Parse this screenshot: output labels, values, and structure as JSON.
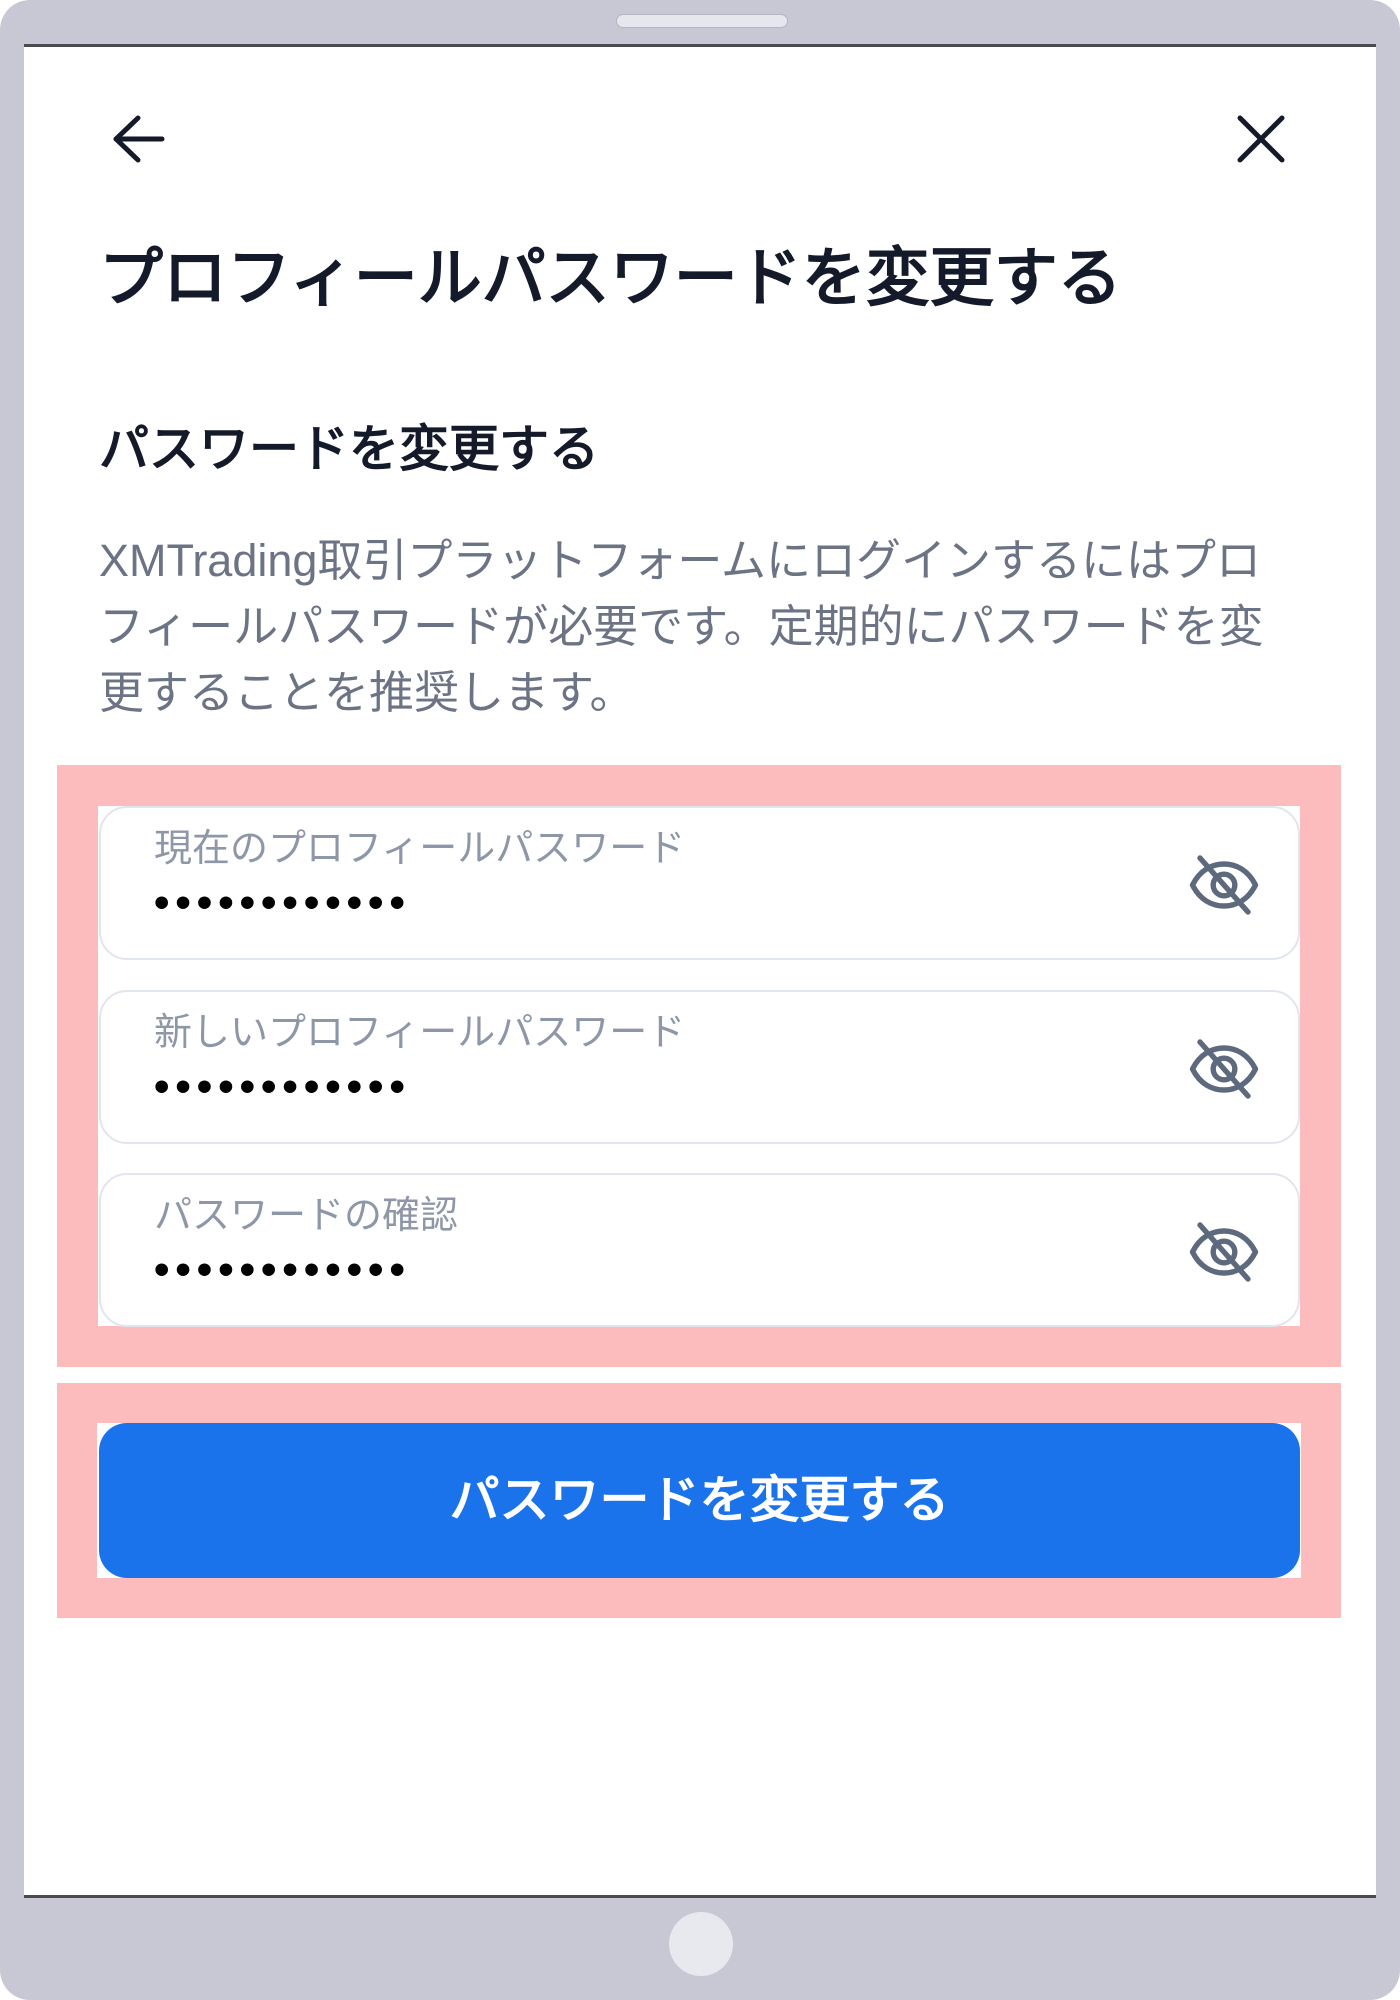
{
  "header": {
    "back_icon": "arrow-left-icon",
    "close_icon": "close-icon"
  },
  "page": {
    "title": "プロフィールパスワードを変更する"
  },
  "section": {
    "heading": "パスワードを変更する",
    "description_lines": [
      "XMTrading取引プラットフォームにログインするにはプロ",
      "フィールパスワードが必要です。定期的にパスワードを変",
      "更することを推奨します。"
    ]
  },
  "fields": [
    {
      "label": "現在のプロフィールパスワード",
      "value": "••••••••••••",
      "toggle_icon": "eye-off-icon"
    },
    {
      "label": "新しいプロフィールパスワード",
      "value": "••••••••••••",
      "toggle_icon": "eye-off-icon"
    },
    {
      "label": "パスワードの確認",
      "value": "••••••••••••",
      "toggle_icon": "eye-off-icon"
    }
  ],
  "submit_button": {
    "label": "パスワードを変更する"
  },
  "colors": {
    "accent": "#1a73eb",
    "highlight": "#fcbcbd",
    "title_text": "#141a2a",
    "body_text": "#6b7385",
    "field_label": "#8e97a8",
    "frame": "#c8c8d5"
  }
}
